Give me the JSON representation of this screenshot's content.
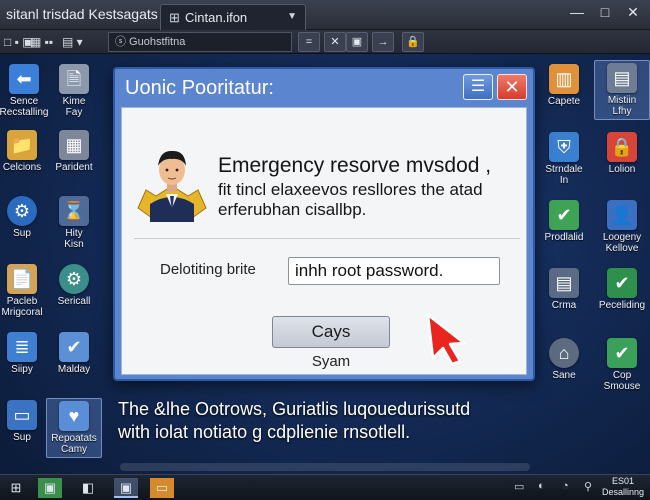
{
  "window": {
    "title": "sitanl trisdad  Kestsagats",
    "tab_label": "Cintan.ifon",
    "tab_icon": "grid-icon",
    "controls": [
      "—",
      "□",
      "✕"
    ]
  },
  "toolbar": {
    "view_label": "□ ▪ ▣",
    "layout_label": "▦ ▪▪",
    "dropdown_label": "▤ ▾",
    "search_placeholder": "ⓢ Guohstfitna",
    "buttons": [
      "=",
      "✕",
      "▣",
      "→",
      "🔒"
    ]
  },
  "desktop_left": [
    {
      "name": "sence-recstalling",
      "icon": "arrow-left-icon",
      "glyph": "⬅",
      "color": "#3c7fd8",
      "label": "Sence",
      "label2": "Recstalling"
    },
    {
      "name": "kime-fay",
      "icon": "document-lock-icon",
      "glyph": "🗎",
      "color": "#8c99ad",
      "label": "Kime",
      "label2": "Fay"
    },
    {
      "name": "celcions",
      "icon": "folder-icon",
      "glyph": "📁",
      "color": "#d8a43c",
      "label": "Celcions",
      "label2": ""
    },
    {
      "name": "parident",
      "icon": "printer-icon",
      "glyph": "▦",
      "color": "#7d8799",
      "label": "Parident",
      "label2": ""
    },
    {
      "name": "sup",
      "icon": "gear-icon",
      "glyph": "⚙",
      "color": "#2b6bbf",
      "label": "Sup",
      "label2": ""
    },
    {
      "name": "hity-kisn",
      "icon": "hourglass-icon",
      "glyph": "⌛",
      "color": "#4e6a99",
      "label": "Hity",
      "label2": "Kisn"
    },
    {
      "name": "pacleb-mrigcoral",
      "icon": "notepad-icon",
      "glyph": "📄",
      "color": "#d3a35a",
      "label": "Pacleb",
      "label2": "Mrigcoral"
    },
    {
      "name": "sericall",
      "icon": "cog-icon",
      "glyph": "⚙",
      "color": "#3b8f8a",
      "label": "Sericall",
      "label2": ""
    },
    {
      "name": "siipy",
      "icon": "list-icon",
      "glyph": "≣",
      "color": "#3f7fd1",
      "label": "Siipy",
      "label2": ""
    },
    {
      "name": "malday",
      "icon": "check-icon",
      "glyph": "✔",
      "color": "#5b8fd6",
      "label": "Malday",
      "label2": ""
    },
    {
      "name": "sup-2",
      "icon": "window-icon",
      "glyph": "▭",
      "color": "#3a72c4",
      "label": "Sup",
      "label2": ""
    },
    {
      "name": "repoatats-camy",
      "icon": "heart-icon",
      "glyph": "♥",
      "color": "#5a8fd8",
      "label": "Repoatats",
      "label2": "Camy"
    }
  ],
  "desktop_right": [
    {
      "name": "capete",
      "icon": "chart-icon",
      "glyph": "▥",
      "color": "#e0913a",
      "label": "Capete",
      "label2": ""
    },
    {
      "name": "mistiin-lfhy",
      "icon": "drive-icon",
      "glyph": "▤",
      "color": "#6e7d94",
      "label": "Mistiin",
      "label2": "Lfhy"
    },
    {
      "name": "strndale-in",
      "icon": "shield-icon",
      "glyph": "⛨",
      "color": "#3a7fd0",
      "label": "Strndale",
      "label2": "In"
    },
    {
      "name": "lolion",
      "icon": "lock-icon",
      "glyph": "🔒",
      "color": "#d9443a",
      "label": "Lolion",
      "label2": ""
    },
    {
      "name": "prodlalid",
      "icon": "check-square-icon",
      "glyph": "✔",
      "color": "#3fa356",
      "label": "Prodlalid",
      "label2": ""
    },
    {
      "name": "loogeny-kellove",
      "icon": "user-lock-icon",
      "glyph": "👤",
      "color": "#3a6fc2",
      "label": "Loogeny",
      "label2": "Kellove"
    },
    {
      "name": "crma",
      "icon": "server-icon",
      "glyph": "▤",
      "color": "#5a6b86",
      "label": "Crma",
      "label2": ""
    },
    {
      "name": "peceliding",
      "icon": "check-list-icon",
      "glyph": "✔",
      "color": "#2f8f4c",
      "label": "Peceliding",
      "label2": ""
    },
    {
      "name": "sane",
      "icon": "bell-icon",
      "glyph": "⌂",
      "color": "#5d6b80",
      "label": "Sane",
      "label2": ""
    },
    {
      "name": "cop-smouse",
      "icon": "checkbox-icon",
      "glyph": "✔",
      "color": "#3aa05a",
      "label": "Cop",
      "label2": "Smouse"
    }
  ],
  "dialog": {
    "title": "Uonic Pooritatur:",
    "minimize_glyph": "☰",
    "close_glyph": "✕",
    "message_line1": "Emergency resorve mvsdod ,",
    "message_line2": "fit tincl elaxeevos resllores the atad",
    "message_line3": "erferubhan cisallbp.",
    "field_label": "Delotiting brite",
    "field_value": "inhh root password.",
    "ok_label": "Cays",
    "sub_label": "Syam"
  },
  "caption": {
    "line1": "The &lhe Ootrows, Guriatlis luqouedurissutd",
    "line2": "with iolat notiato g cdplienie rnsotlell."
  },
  "taskbar": {
    "items": [
      "⊞",
      "▣",
      "◧",
      "▣",
      "▭"
    ],
    "tray": [
      "▭",
      "◐",
      "◔",
      "⚲"
    ],
    "clock_line1": "ES01",
    "clock_line2": "Desallinng"
  }
}
